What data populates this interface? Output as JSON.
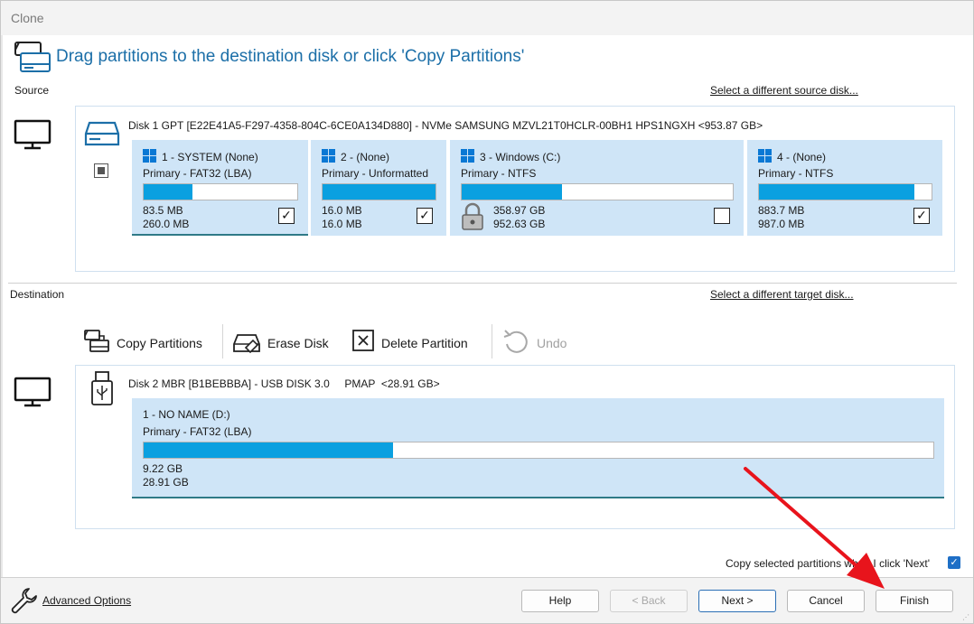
{
  "window": {
    "title": "Clone"
  },
  "header": {
    "title": "Drag partitions to the destination disk or click 'Copy Partitions'"
  },
  "source": {
    "label": "Source",
    "change_link": "Select a different source disk...",
    "disk_desc": "Disk 1 GPT [E22E41A5-F297-4358-804C-6CE0A134D880] - NVMe SAMSUNG MZVL21T0HCLR-00BH1 HPS1NGXH  <953.87 GB>",
    "partitions": [
      {
        "name": "1 - SYSTEM (None)",
        "type": "Primary - FAT32 (LBA)",
        "used": "83.5 MB",
        "total": "260.0 MB",
        "fill": 0.32,
        "checked": true,
        "check_glyph": "✓"
      },
      {
        "name": "2 -  (None)",
        "type": "Primary - Unformatted",
        "used": "16.0 MB",
        "total": "16.0 MB",
        "fill": 1.0,
        "checked": true,
        "check_glyph": "✓"
      },
      {
        "name": "3 - Windows (C:)",
        "type": "Primary - NTFS",
        "used": "358.97 GB",
        "total": "952.63 GB",
        "fill": 0.37,
        "checked": false,
        "check_glyph": ""
      },
      {
        "name": "4 -  (None)",
        "type": "Primary - NTFS",
        "used": "883.7 MB",
        "total": "987.0 MB",
        "fill": 0.9,
        "checked": true,
        "check_glyph": "✓"
      }
    ]
  },
  "destination": {
    "label": "Destination",
    "change_link": "Select a different target disk...",
    "toolbar": {
      "copy_partitions": "Copy Partitions",
      "erase_disk": "Erase Disk",
      "delete_partition": "Delete Partition",
      "undo": "Undo"
    },
    "disk_desc": "Disk 2 MBR [B1BEBBBA] - USB DISK 3.0     PMAP  <28.91 GB>",
    "partition": {
      "name": "1 - NO NAME (D:)",
      "type": "Primary - FAT32 (LBA)",
      "used": "9.22 GB",
      "total": "28.91 GB",
      "fill": 0.316
    }
  },
  "copy_selected": {
    "label": "Copy selected partitions when I click 'Next'",
    "checked": true,
    "check_glyph": "✓"
  },
  "footer": {
    "advanced_options": "Advanced Options",
    "help": "Help",
    "back": "< Back",
    "next": "Next >",
    "cancel": "Cancel",
    "finish": "Finish"
  },
  "colors": {
    "accent": "#1c6fa8",
    "bar_fill": "#0aa0e0",
    "partition_bg": "#cfe5f7",
    "annotation_arrow": "#e8141c"
  },
  "icons": [
    "disk-clone-icon",
    "monitor-icon",
    "drive-icon",
    "windows-logo-icon",
    "usb-drive-icon",
    "copy-partitions-icon",
    "erase-disk-icon",
    "delete-partition-icon",
    "undo-icon",
    "wrench-icon",
    "lock-icon",
    "red-arrow"
  ]
}
